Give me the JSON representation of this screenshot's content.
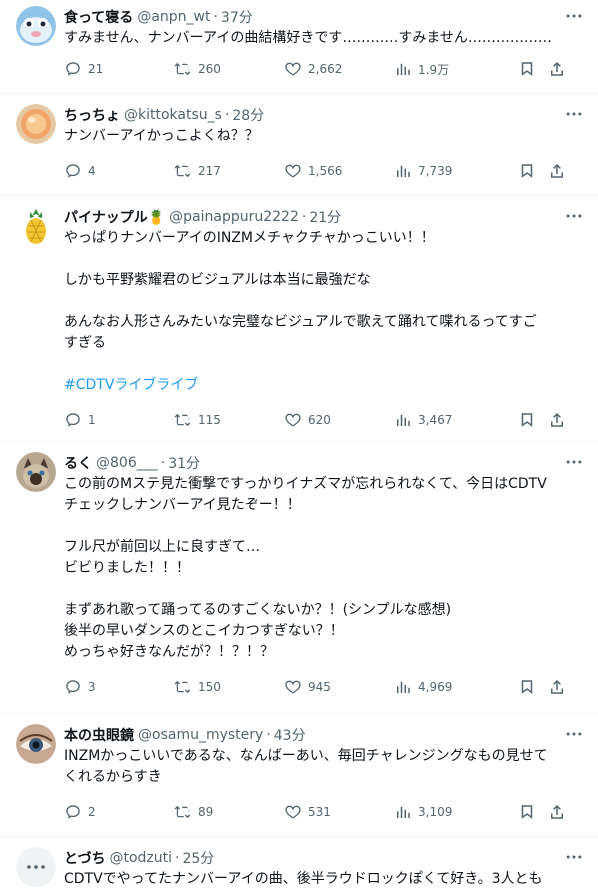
{
  "tweets": [
    {
      "name": "食って寝る",
      "handle": "@anpn_wt",
      "time": "37分",
      "text": [
        "すみません、ナンバーアイの曲結構好きです…………すみません………………"
      ],
      "replies": "21",
      "retweets": "260",
      "likes": "2,662",
      "views": "1.9万"
    },
    {
      "name": "ちっちょ",
      "handle": "@kittokatsu_s",
      "time": "28分",
      "text": [
        "ナンバーアイかっこよくね？？"
      ],
      "replies": "4",
      "retweets": "217",
      "likes": "1,566",
      "views": "7,739"
    },
    {
      "name": "パイナップル🍍",
      "handle": "@painappuru2222",
      "time": "21分",
      "text": [
        "やっぱりナンバーアイのINZMメチャクチャかっこいい！！",
        "",
        "しかも平野紫耀君のビジュアルは本当に最強だな",
        "",
        "あんなお人形さんみたいな完璧なビジュアルで歌えて踊れて喋れるってすご",
        "すぎる",
        ""
      ],
      "hashtag": "#CDTVライブライブ",
      "replies": "1",
      "retweets": "115",
      "likes": "620",
      "views": "3,467"
    },
    {
      "name": "るく",
      "handle": "@806___",
      "time": "31分",
      "text": [
        "この前のMステ見た衝撃ですっかりイナズマが忘れられなくて、今日はCDTV",
        "チェックしナンバーアイ見たぞー！！",
        "",
        "フル尺が前回以上に良すぎて…",
        "ビビりました！！！",
        "",
        "まずあれ歌って踊ってるのすごくないか？！(シンプルな感想)",
        "後半の早いダンスのとこイカつすぎない？！",
        "めっちゃ好きなんだが？！？！？"
      ],
      "replies": "3",
      "retweets": "150",
      "likes": "945",
      "views": "4,969"
    },
    {
      "name": "本の虫眼鏡",
      "handle": "@osamu_mystery",
      "time": "43分",
      "text": [
        "INZMかっこいいであるな、なんばーあい、毎回チャレンジングなもの見せて",
        "くれるからすき"
      ],
      "replies": "2",
      "retweets": "89",
      "likes": "531",
      "views": "3,109"
    },
    {
      "name": "とづち",
      "handle": "@todzuti",
      "time": "25分",
      "text": [
        "CDTVでやってたナンバーアイの曲、後半ラウドロックぽくて好き。3人とも"
      ],
      "replies": "",
      "retweets": "",
      "likes": "",
      "views": ""
    }
  ],
  "icons": {
    "more": "more-icon",
    "reply": "reply-icon",
    "retweet": "retweet-icon",
    "like": "like-icon",
    "views": "views-icon",
    "bookmark": "bookmark-icon",
    "share": "share-icon"
  },
  "colors": {
    "accent": "#1d9bf0",
    "muted": "#536471",
    "text": "#0f1419",
    "divider": "#eff3f4"
  }
}
